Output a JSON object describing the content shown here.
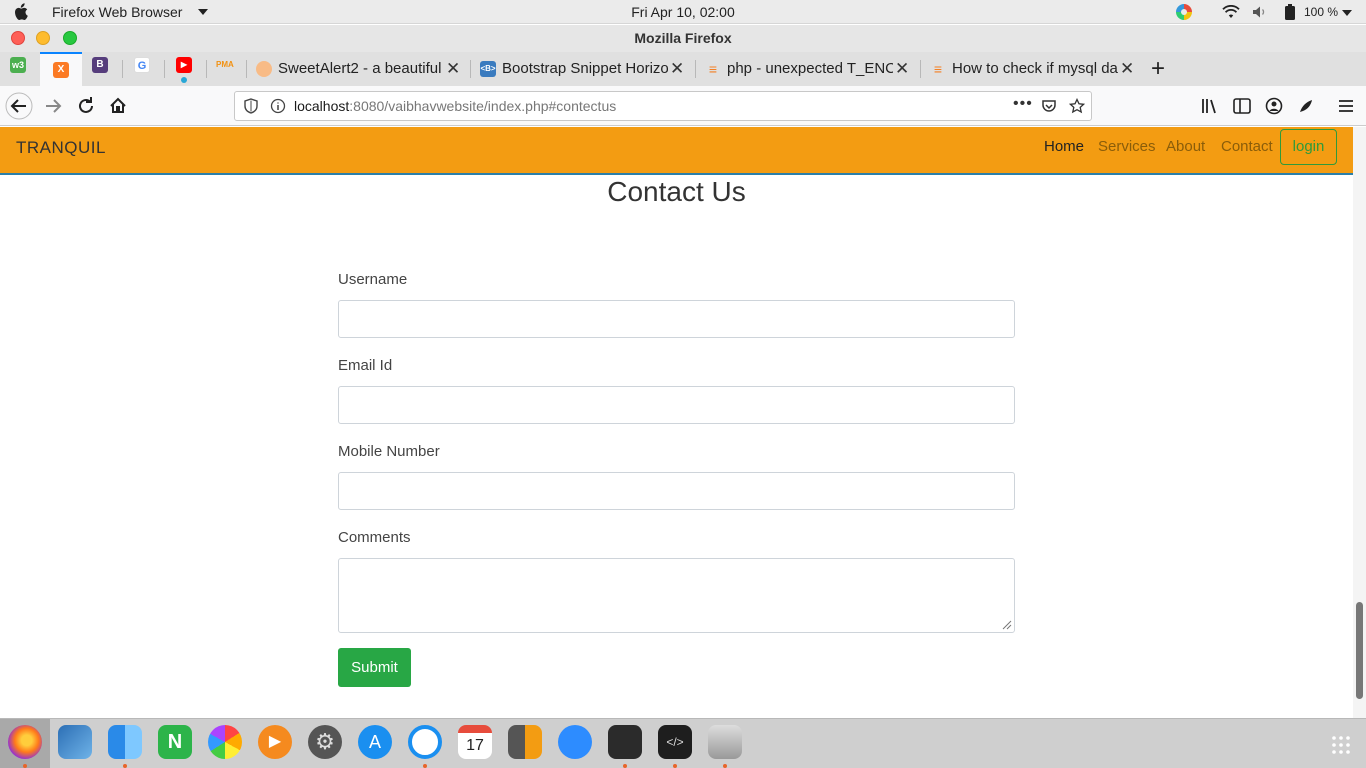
{
  "system_bar": {
    "app_name": "Firefox Web Browser",
    "clock": "Fri Apr 10, 02:00",
    "battery": "100 %"
  },
  "window": {
    "title": "Mozilla Firefox"
  },
  "tabs": [
    {
      "title": "SweetAlert2 - a beautiful",
      "icon": "sweetalert-icon"
    },
    {
      "title": "Bootstrap Snippet Horizo",
      "icon": "bootstrap-snippet-icon"
    },
    {
      "title": "php - unexpected T_ENC",
      "icon": "stackoverflow-icon"
    },
    {
      "title": "How to check if mysql da",
      "icon": "stackoverflow-icon"
    }
  ],
  "address_bar": {
    "host": "localhost",
    "path": ":8080/vaibhavwebsite/index.php#contectus"
  },
  "site": {
    "brand": "TRANQUIL",
    "nav": {
      "home": "Home",
      "services": "Services",
      "about": "About",
      "contact": "Contact",
      "login": "login"
    },
    "colors": {
      "navbar": "#f39c12",
      "submit": "#28a745",
      "login_border": "#2f9a3a"
    }
  },
  "form": {
    "heading": "Contact Us",
    "username_label": "Username",
    "username_value": "",
    "email_label": "Email Id",
    "email_value": "",
    "mobile_label": "Mobile Number",
    "mobile_value": "",
    "comments_label": "Comments",
    "comments_value": "",
    "submit_label": "Submit"
  },
  "dock": {
    "calendar_day": "17"
  }
}
